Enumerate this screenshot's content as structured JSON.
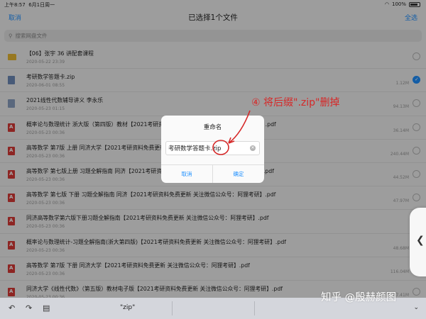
{
  "status": {
    "time": "上午8:57",
    "date": "6月1日周一",
    "battery": "100%"
  },
  "nav": {
    "cancel": "取消",
    "title": "已选择1个文件",
    "select_all": "全选"
  },
  "search": {
    "placeholder": "搜索网盘文件"
  },
  "files": [
    {
      "name": "【06】张宇 36 讲配套课程",
      "date": "2020-05-22 23:39",
      "size": "",
      "type": "folder",
      "checked": false
    },
    {
      "name": "考研数学答题卡.zip",
      "date": "2020-06-01 08:55",
      "size": "1.12M",
      "type": "zip",
      "checked": true
    },
    {
      "name": "2021线性代数辅导讲义 李永乐",
      "date": "2020-05-23 01:15",
      "size": "94.13M",
      "type": "doc",
      "checked": false
    },
    {
      "name": "概率论与数理统计 浙大版（第四版）教材【2021考研资料免费更新 关注微信公众号：阿狸考研】.pdf",
      "date": "2020-05-23 00:36",
      "size": "36.14M",
      "type": "pdf",
      "checked": false
    },
    {
      "name": "高等数学 第7版 上册 同济大学【2021考研资料免费更新 关注微信公众号：阿狸考研】.pdf",
      "date": "2020-05-23 00:36",
      "size": "240.44M",
      "type": "pdf",
      "checked": false
    },
    {
      "name": "高等数学 第七版上册 习题全解指南 同济【2021考研资料免费更新 关注微信公众号：阿狸考研】.pdf",
      "date": "2020-05-23 00:36",
      "size": "44.52M",
      "type": "pdf",
      "checked": false
    },
    {
      "name": "高等数学 第七版 下册 习题全解指南 同济【2021考研资料免费更新 关注微信公众号：阿狸考研】.pdf",
      "date": "2020-05-23 00:36",
      "size": "47.97M",
      "type": "pdf",
      "checked": false
    },
    {
      "name": "同济高等数学第六版下册习题全解指南【2021考研资料免费更新 关注微信公众号：阿狸考研】.pdf",
      "date": "2020-05-23 00:36",
      "size": "",
      "type": "pdf",
      "checked": false
    },
    {
      "name": "概率论与数理统计-习题全解指南(浙大第四版)【2021考研资料免费更新 关注微信公众号：阿狸考研】.pdf",
      "date": "2020-05-23 00:36",
      "size": "48.68M",
      "type": "pdf",
      "checked": false
    },
    {
      "name": "高等数学 第7版 下册 同济大学【2021考研资料免费更新 关注微信公众号：阿狸考研】.pdf",
      "date": "2020-05-23 00:36",
      "size": "116.04M",
      "type": "pdf",
      "checked": false
    },
    {
      "name": "同济大学《线性代数》（第五版）教材电子版【2021考研资料免费更新 关注微信公众号：阿狸考研】.pdf",
      "date": "2020-05-23 00:36",
      "size": "7.41M",
      "type": "pdf",
      "checked": false
    }
  ],
  "dialog": {
    "title": "重命名",
    "value": "考研数学答题卡.zip",
    "cancel": "取消",
    "confirm": "确定"
  },
  "annotation": {
    "text": "④ 将后缀\".zip\"删掉"
  },
  "keyboard": {
    "suggestion": "\"zip\"",
    "undo_icon": "undo-icon",
    "redo_icon": "redo-icon",
    "paste_icon": "paste-icon",
    "dismiss_icon": "keyboard-dismiss-icon"
  },
  "watermark": {
    "text": "知乎 @殷赫颜图"
  },
  "colors": {
    "accent": "#1e90ff",
    "pdf": "#d93a36",
    "folder": "#e8b934",
    "annotation": "#d62828"
  }
}
